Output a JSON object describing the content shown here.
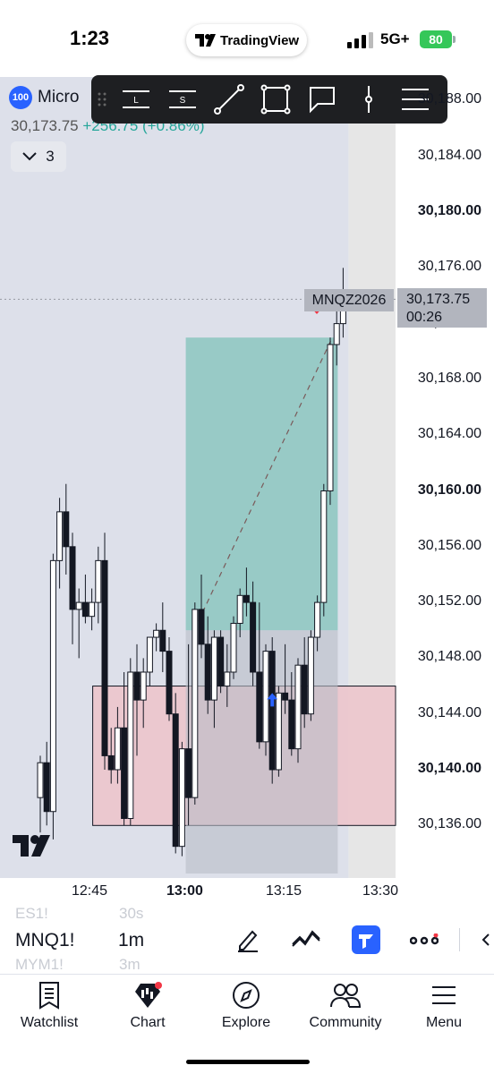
{
  "status_bar": {
    "time": "1:23",
    "app_pill": "TradingView",
    "network": "5G+",
    "battery": "80"
  },
  "symbol": {
    "badge": "100",
    "name": "Micro",
    "last": "30,173.75",
    "change": "+256.75 (+0.86%)",
    "indicators_count": "3"
  },
  "drawing_toolbar": {
    "tools": [
      "horizontal-line-long-icon",
      "horizontal-line-short-icon",
      "trend-line-icon",
      "rectangle-icon",
      "callout-icon",
      "vertical-line-icon",
      "menu-lines-icon"
    ],
    "long_label": "L",
    "short_label": "S"
  },
  "price_axis": {
    "labels": [
      "30,188.00",
      "30,184.00",
      "30,180.00",
      "30,176.00",
      "30,172.00",
      "30,168.00",
      "30,164.00",
      "30,160.00",
      "30,156.00",
      "30,152.00",
      "30,148.00",
      "30,144.00",
      "30,140.00",
      "30,136.00"
    ],
    "bold": [
      "30,180.00",
      "30,160.00",
      "30,140.00"
    ],
    "current_price": "30,173.75",
    "countdown": "00:26",
    "symbol_tag": "MNQZ2026"
  },
  "time_axis": {
    "labels": [
      "12:45",
      "13:00",
      "13:15",
      "13:30"
    ]
  },
  "chart_data": {
    "type": "candlestick",
    "timeframe": "1m",
    "ylim": [
      30133.5,
      30190
    ],
    "x": [
      "12:37",
      "12:38",
      "12:39",
      "12:40",
      "12:41",
      "12:42",
      "12:43",
      "12:44",
      "12:45",
      "12:46",
      "12:47",
      "12:48",
      "12:49",
      "12:50",
      "12:51",
      "12:52",
      "12:53",
      "12:54",
      "12:55",
      "12:56",
      "12:57",
      "12:58",
      "12:59",
      "13:00",
      "13:01",
      "13:02",
      "13:03",
      "13:04",
      "13:05",
      "13:06",
      "13:07",
      "13:08",
      "13:09",
      "13:10",
      "13:11",
      "13:12",
      "13:13",
      "13:14",
      "13:15",
      "13:16",
      "13:17",
      "13:18",
      "13:19",
      "13:20",
      "13:21",
      "13:22",
      "13:23",
      "13:24",
      "13:25",
      "13:26",
      "13:27",
      "13:28"
    ],
    "ohlc": [
      [
        30138.0,
        30141.0,
        30135.5,
        30140.5
      ],
      [
        30140.5,
        30142.0,
        30136.0,
        30137.0
      ],
      [
        30137.0,
        30155.5,
        30135.0,
        30155.0
      ],
      [
        30155.0,
        30159.5,
        30153.0,
        30158.5
      ],
      [
        30158.5,
        30160.5,
        30154.0,
        30156.0
      ],
      [
        30156.0,
        30157.0,
        30149.0,
        30151.5
      ],
      [
        30151.5,
        30153.0,
        30148.0,
        30152.0
      ],
      [
        30152.0,
        30154.0,
        30150.5,
        30151.0
      ],
      [
        30151.0,
        30153.0,
        30150.0,
        30152.0
      ],
      [
        30152.0,
        30156.0,
        30150.5,
        30155.0
      ],
      [
        30155.0,
        30157.0,
        30140.0,
        30141.0
      ],
      [
        30141.0,
        30143.0,
        30139.0,
        30140.0
      ],
      [
        30140.0,
        30144.5,
        30139.0,
        30143.0
      ],
      [
        30143.0,
        30147.0,
        30136.0,
        30136.5
      ],
      [
        30136.5,
        30148.0,
        30136.0,
        30147.0
      ],
      [
        30147.0,
        30149.0,
        30141.0,
        30145.0
      ],
      [
        30145.0,
        30148.0,
        30143.0,
        30147.0
      ],
      [
        30147.0,
        30149.5,
        30146.0,
        30149.5
      ],
      [
        30149.5,
        30150.5,
        30148.5,
        30150.0
      ],
      [
        30150.0,
        30152.0,
        30147.0,
        30148.5
      ],
      [
        30148.5,
        30149.5,
        30143.5,
        30144.0
      ],
      [
        30144.0,
        30145.5,
        30134.0,
        30134.5
      ],
      [
        30134.5,
        30142.0,
        30133.8,
        30141.5
      ],
      [
        30141.5,
        30149.0,
        30136.0,
        30138.0
      ],
      [
        30138.0,
        30152.0,
        30137.5,
        30151.5
      ],
      [
        30151.5,
        30154.0,
        30148.0,
        30149.0
      ],
      [
        30149.0,
        30151.0,
        30144.0,
        30145.0
      ],
      [
        30145.0,
        30150.0,
        30143.0,
        30149.5
      ],
      [
        30149.5,
        30150.0,
        30145.5,
        30146.0
      ],
      [
        30146.0,
        30149.0,
        30144.5,
        30147.0
      ],
      [
        30147.0,
        30151.0,
        30146.5,
        30150.5
      ],
      [
        30150.5,
        30153.0,
        30149.5,
        30152.5
      ],
      [
        30152.5,
        30154.5,
        30151.0,
        30152.0
      ],
      [
        30152.0,
        30153.5,
        30146.0,
        30147.0
      ],
      [
        30147.0,
        30152.0,
        30141.5,
        30142.0
      ],
      [
        30142.0,
        30149.0,
        30141.0,
        30148.5
      ],
      [
        30148.5,
        30149.5,
        30139.0,
        30140.0
      ],
      [
        30140.0,
        30146.0,
        30139.5,
        30145.5
      ],
      [
        30145.5,
        30149.0,
        30144.0,
        30145.0
      ],
      [
        30145.0,
        30147.0,
        30141.0,
        30141.5
      ],
      [
        30141.5,
        30148.0,
        30140.5,
        30147.5
      ],
      [
        30147.5,
        30149.5,
        30143.0,
        30144.0
      ],
      [
        30144.0,
        30150.0,
        30143.5,
        30149.5
      ],
      [
        30149.5,
        30152.5,
        30148.5,
        30152.0
      ],
      [
        30152.0,
        30160.5,
        30151.0,
        30160.0
      ],
      [
        30160.0,
        30171.0,
        30159.0,
        30170.5
      ],
      [
        30170.5,
        30173.0,
        30169.0,
        30172.0
      ],
      [
        30172.0,
        30176.0,
        30171.0,
        30173.75
      ]
    ],
    "position": {
      "side": "long",
      "entry": 30150.0,
      "target": 30171.0,
      "stop": 30146.0
    },
    "zones": [
      {
        "type": "rectangle",
        "top": 30146.0,
        "bottom": 30136.0
      }
    ]
  },
  "ticker_bar": {
    "symbol": "MNQ1!",
    "interval": "1m",
    "ghost_above": [
      "ES1!",
      "30s"
    ],
    "ghost_below": [
      "MYM1!",
      "3m"
    ]
  },
  "tab_bar": {
    "items": [
      {
        "label": "Watchlist",
        "icon": "watchlist-icon"
      },
      {
        "label": "Chart",
        "icon": "chart-icon"
      },
      {
        "label": "Explore",
        "icon": "compass-icon"
      },
      {
        "label": "Community",
        "icon": "community-icon"
      },
      {
        "label": "Menu",
        "icon": "menu-icon"
      }
    ]
  },
  "colors": {
    "up": "#ffffff",
    "down": "#131722",
    "target_zone": "#8cc5bf",
    "stop_zone": "#b9bcc6",
    "rect_zone": "#ecc5cc",
    "accent": "#2962ff"
  }
}
